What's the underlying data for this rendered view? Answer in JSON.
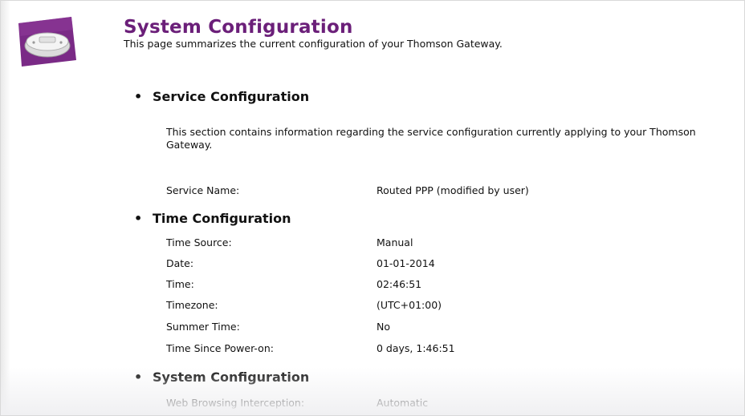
{
  "header": {
    "title": "System Configuration",
    "description": "This page summarizes the current configuration of your Thomson Gateway."
  },
  "service": {
    "heading": "Service Configuration",
    "description": "This section contains information regarding the service configuration currently applying to your Thomson Gateway.",
    "rows": [
      {
        "label": "Service Name:",
        "value": "Routed PPP (modified by user)"
      }
    ]
  },
  "time": {
    "heading": "Time Configuration",
    "rows": [
      {
        "label": "Time Source:",
        "value": "Manual"
      },
      {
        "label": "Date:",
        "value": "01-01-2014"
      },
      {
        "label": "Time:",
        "value": "02:46:51"
      },
      {
        "label": "Timezone:",
        "value": "(UTC+01:00)"
      },
      {
        "label": "Summer Time:",
        "value": "No"
      },
      {
        "label": "Time Since Power-on:",
        "value": "0 days, 1:46:51"
      }
    ]
  },
  "system": {
    "heading": "System Configuration",
    "rows": [
      {
        "label": "Web Browsing Interception:",
        "value": "Automatic"
      }
    ]
  },
  "icons": {
    "hero": "router-icon",
    "accent": "#6b1f79"
  }
}
